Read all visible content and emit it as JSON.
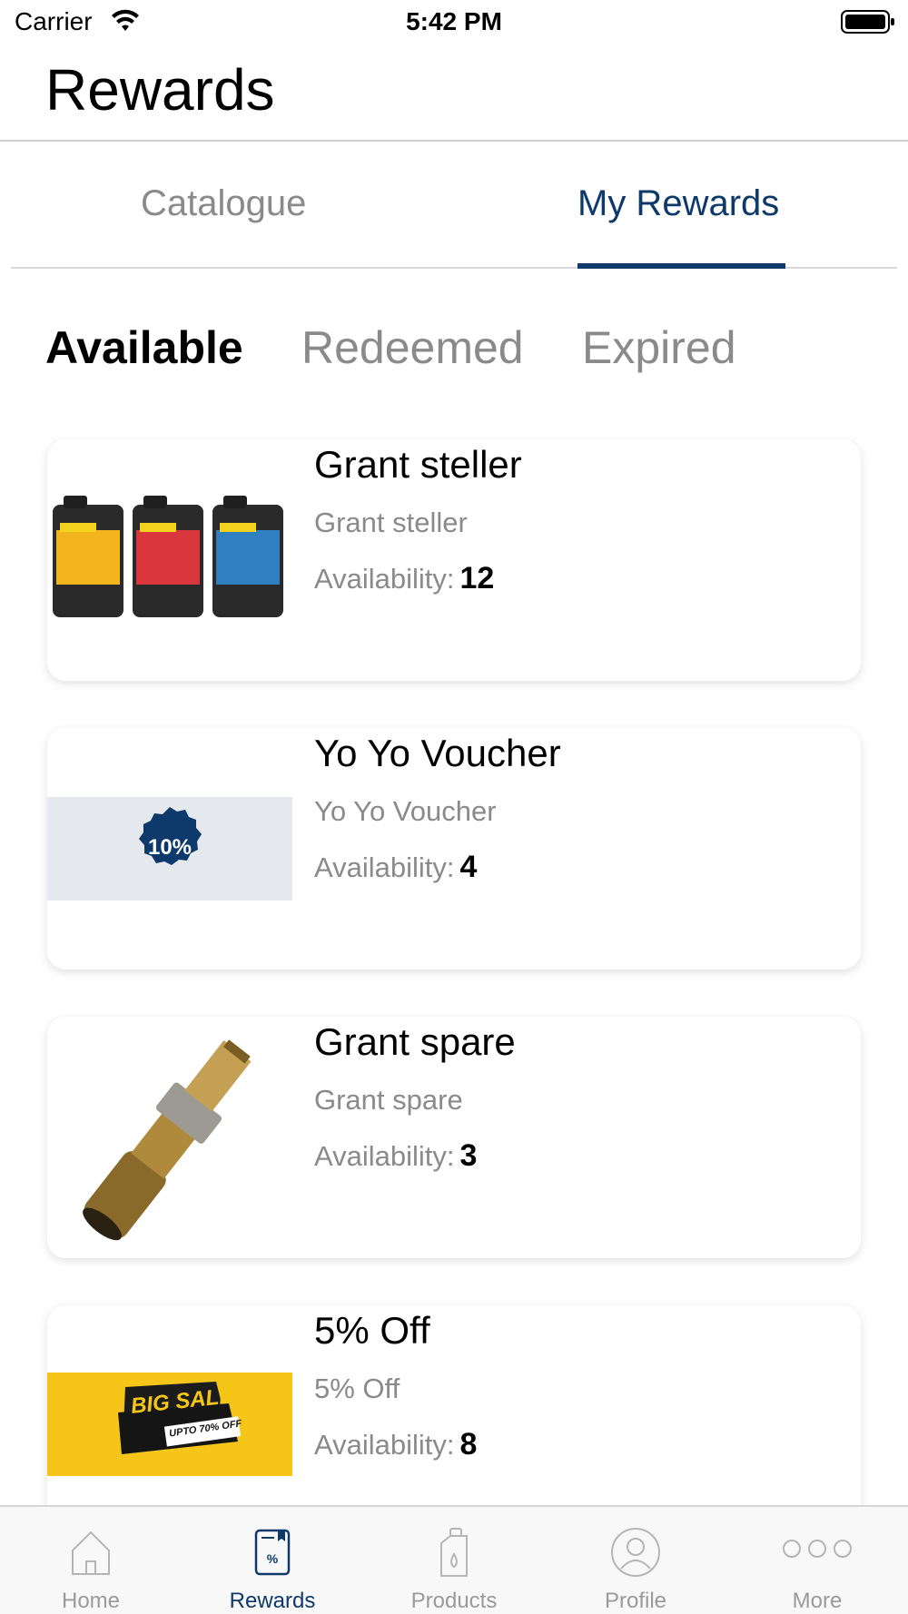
{
  "status_bar": {
    "carrier": "Carrier",
    "time": "5:42 PM"
  },
  "header": {
    "title": "Rewards"
  },
  "top_tabs": [
    {
      "label": "Catalogue",
      "active": false
    },
    {
      "label": "My Rewards",
      "active": true
    }
  ],
  "sub_tabs": [
    {
      "label": "Available",
      "active": true
    },
    {
      "label": "Redeemed",
      "active": false
    },
    {
      "label": "Expired",
      "active": false
    }
  ],
  "availability_label": "Availability:",
  "rewards": [
    {
      "title": "Grant steller",
      "subtitle": "Grant steller",
      "availability": "12",
      "image": "oil-cans"
    },
    {
      "title": "Yo Yo Voucher",
      "subtitle": "Yo Yo Voucher",
      "availability": "4",
      "image": "discount-badge",
      "badge_text": "10%"
    },
    {
      "title": "Grant spare",
      "subtitle": "Grant spare",
      "availability": "3",
      "image": "brass-fitting"
    },
    {
      "title": "5% Off",
      "subtitle": "5% Off",
      "availability": "8",
      "image": "sale-banner",
      "banner_text": "BIG SALE",
      "banner_sub": "UPTO 70% OFF"
    }
  ],
  "bottom_nav": [
    {
      "label": "Home",
      "icon": "home-icon",
      "active": false
    },
    {
      "label": "Rewards",
      "icon": "rewards-icon",
      "active": true
    },
    {
      "label": "Products",
      "icon": "products-icon",
      "active": false
    },
    {
      "label": "Profile",
      "icon": "profile-icon",
      "active": false
    },
    {
      "label": "More",
      "icon": "more-icon",
      "active": false
    }
  ],
  "colors": {
    "accent": "#0d3a6b",
    "inactive": "#8a8a8a",
    "sale_yellow": "#f5c518"
  }
}
